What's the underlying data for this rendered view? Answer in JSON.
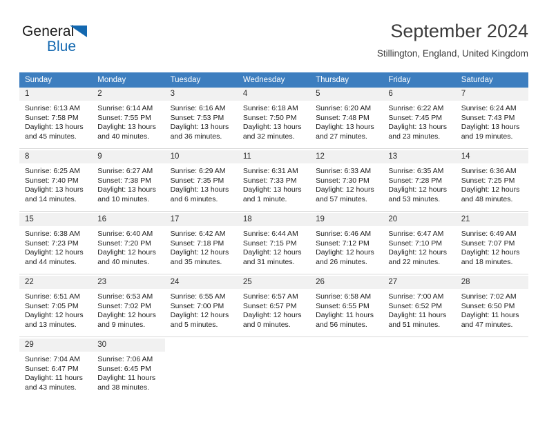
{
  "logo": {
    "word1": "General",
    "word2": "Blue",
    "triangle_color": "#1368b0"
  },
  "header": {
    "title": "September 2024",
    "subtitle": "Stillington, England, United Kingdom"
  },
  "theme": {
    "header_bg": "#3d7ebf",
    "daynum_bg": "#f1f1f1",
    "text": "#1d1d1d"
  },
  "columns": [
    "Sunday",
    "Monday",
    "Tuesday",
    "Wednesday",
    "Thursday",
    "Friday",
    "Saturday"
  ],
  "weeks": [
    [
      {
        "day": "1",
        "l1": "Sunrise: 6:13 AM",
        "l2": "Sunset: 7:58 PM",
        "l3": "Daylight: 13 hours",
        "l4": "and 45 minutes."
      },
      {
        "day": "2",
        "l1": "Sunrise: 6:14 AM",
        "l2": "Sunset: 7:55 PM",
        "l3": "Daylight: 13 hours",
        "l4": "and 40 minutes."
      },
      {
        "day": "3",
        "l1": "Sunrise: 6:16 AM",
        "l2": "Sunset: 7:53 PM",
        "l3": "Daylight: 13 hours",
        "l4": "and 36 minutes."
      },
      {
        "day": "4",
        "l1": "Sunrise: 6:18 AM",
        "l2": "Sunset: 7:50 PM",
        "l3": "Daylight: 13 hours",
        "l4": "and 32 minutes."
      },
      {
        "day": "5",
        "l1": "Sunrise: 6:20 AM",
        "l2": "Sunset: 7:48 PM",
        "l3": "Daylight: 13 hours",
        "l4": "and 27 minutes."
      },
      {
        "day": "6",
        "l1": "Sunrise: 6:22 AM",
        "l2": "Sunset: 7:45 PM",
        "l3": "Daylight: 13 hours",
        "l4": "and 23 minutes."
      },
      {
        "day": "7",
        "l1": "Sunrise: 6:24 AM",
        "l2": "Sunset: 7:43 PM",
        "l3": "Daylight: 13 hours",
        "l4": "and 19 minutes."
      }
    ],
    [
      {
        "day": "8",
        "l1": "Sunrise: 6:25 AM",
        "l2": "Sunset: 7:40 PM",
        "l3": "Daylight: 13 hours",
        "l4": "and 14 minutes."
      },
      {
        "day": "9",
        "l1": "Sunrise: 6:27 AM",
        "l2": "Sunset: 7:38 PM",
        "l3": "Daylight: 13 hours",
        "l4": "and 10 minutes."
      },
      {
        "day": "10",
        "l1": "Sunrise: 6:29 AM",
        "l2": "Sunset: 7:35 PM",
        "l3": "Daylight: 13 hours",
        "l4": "and 6 minutes."
      },
      {
        "day": "11",
        "l1": "Sunrise: 6:31 AM",
        "l2": "Sunset: 7:33 PM",
        "l3": "Daylight: 13 hours",
        "l4": "and 1 minute."
      },
      {
        "day": "12",
        "l1": "Sunrise: 6:33 AM",
        "l2": "Sunset: 7:30 PM",
        "l3": "Daylight: 12 hours",
        "l4": "and 57 minutes."
      },
      {
        "day": "13",
        "l1": "Sunrise: 6:35 AM",
        "l2": "Sunset: 7:28 PM",
        "l3": "Daylight: 12 hours",
        "l4": "and 53 minutes."
      },
      {
        "day": "14",
        "l1": "Sunrise: 6:36 AM",
        "l2": "Sunset: 7:25 PM",
        "l3": "Daylight: 12 hours",
        "l4": "and 48 minutes."
      }
    ],
    [
      {
        "day": "15",
        "l1": "Sunrise: 6:38 AM",
        "l2": "Sunset: 7:23 PM",
        "l3": "Daylight: 12 hours",
        "l4": "and 44 minutes."
      },
      {
        "day": "16",
        "l1": "Sunrise: 6:40 AM",
        "l2": "Sunset: 7:20 PM",
        "l3": "Daylight: 12 hours",
        "l4": "and 40 minutes."
      },
      {
        "day": "17",
        "l1": "Sunrise: 6:42 AM",
        "l2": "Sunset: 7:18 PM",
        "l3": "Daylight: 12 hours",
        "l4": "and 35 minutes."
      },
      {
        "day": "18",
        "l1": "Sunrise: 6:44 AM",
        "l2": "Sunset: 7:15 PM",
        "l3": "Daylight: 12 hours",
        "l4": "and 31 minutes."
      },
      {
        "day": "19",
        "l1": "Sunrise: 6:46 AM",
        "l2": "Sunset: 7:12 PM",
        "l3": "Daylight: 12 hours",
        "l4": "and 26 minutes."
      },
      {
        "day": "20",
        "l1": "Sunrise: 6:47 AM",
        "l2": "Sunset: 7:10 PM",
        "l3": "Daylight: 12 hours",
        "l4": "and 22 minutes."
      },
      {
        "day": "21",
        "l1": "Sunrise: 6:49 AM",
        "l2": "Sunset: 7:07 PM",
        "l3": "Daylight: 12 hours",
        "l4": "and 18 minutes."
      }
    ],
    [
      {
        "day": "22",
        "l1": "Sunrise: 6:51 AM",
        "l2": "Sunset: 7:05 PM",
        "l3": "Daylight: 12 hours",
        "l4": "and 13 minutes."
      },
      {
        "day": "23",
        "l1": "Sunrise: 6:53 AM",
        "l2": "Sunset: 7:02 PM",
        "l3": "Daylight: 12 hours",
        "l4": "and 9 minutes."
      },
      {
        "day": "24",
        "l1": "Sunrise: 6:55 AM",
        "l2": "Sunset: 7:00 PM",
        "l3": "Daylight: 12 hours",
        "l4": "and 5 minutes."
      },
      {
        "day": "25",
        "l1": "Sunrise: 6:57 AM",
        "l2": "Sunset: 6:57 PM",
        "l3": "Daylight: 12 hours",
        "l4": "and 0 minutes."
      },
      {
        "day": "26",
        "l1": "Sunrise: 6:58 AM",
        "l2": "Sunset: 6:55 PM",
        "l3": "Daylight: 11 hours",
        "l4": "and 56 minutes."
      },
      {
        "day": "27",
        "l1": "Sunrise: 7:00 AM",
        "l2": "Sunset: 6:52 PM",
        "l3": "Daylight: 11 hours",
        "l4": "and 51 minutes."
      },
      {
        "day": "28",
        "l1": "Sunrise: 7:02 AM",
        "l2": "Sunset: 6:50 PM",
        "l3": "Daylight: 11 hours",
        "l4": "and 47 minutes."
      }
    ],
    [
      {
        "day": "29",
        "l1": "Sunrise: 7:04 AM",
        "l2": "Sunset: 6:47 PM",
        "l3": "Daylight: 11 hours",
        "l4": "and 43 minutes."
      },
      {
        "day": "30",
        "l1": "Sunrise: 7:06 AM",
        "l2": "Sunset: 6:45 PM",
        "l3": "Daylight: 11 hours",
        "l4": "and 38 minutes."
      },
      {
        "day": "",
        "l1": "",
        "l2": "",
        "l3": "",
        "l4": ""
      },
      {
        "day": "",
        "l1": "",
        "l2": "",
        "l3": "",
        "l4": ""
      },
      {
        "day": "",
        "l1": "",
        "l2": "",
        "l3": "",
        "l4": ""
      },
      {
        "day": "",
        "l1": "",
        "l2": "",
        "l3": "",
        "l4": ""
      },
      {
        "day": "",
        "l1": "",
        "l2": "",
        "l3": "",
        "l4": ""
      }
    ]
  ]
}
